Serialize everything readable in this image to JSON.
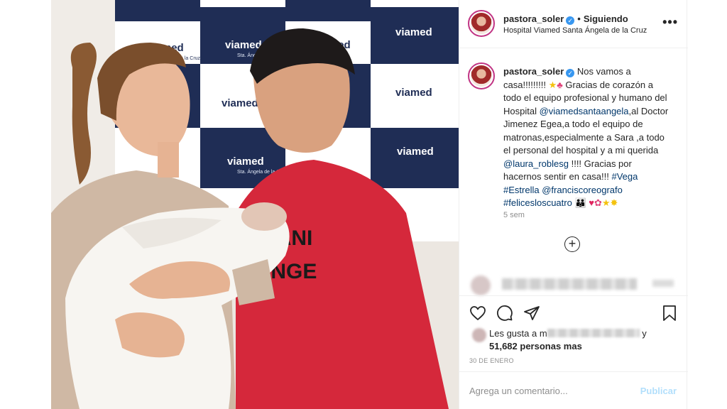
{
  "post": {
    "username": "pastora_soler",
    "verified_mark": "✓",
    "separator": "•",
    "follow_status": "Siguiendo",
    "location": "Hospital Viamed Santa Ángela de la Cruz",
    "more_icon": "more-horizontal-icon",
    "more_label": "•••"
  },
  "photo": {
    "backdrop_logo": "viamed",
    "backdrop_logo_small": "Hospital",
    "backdrop_sub": "Sta. Ángela de la Cruz",
    "shirt_line1": "RMANI",
    "shirt_line2": "HANGE"
  },
  "caption": {
    "username": "pastora_soler",
    "part1": " Nos vamos a casa!!!!!!!!! ",
    "star1": "★",
    "flower1": "♣",
    "part2": " Gracias de corazón a todo el equipo profesional y humano del Hospital ",
    "mention1": "@viamedsantaangela",
    "part3": ",al Doctor Jimenez Egea,a todo el equipo de matronas,especialmente a Sara ,a todo el personal del hospital y a mi querida ",
    "mention2": "@laura_roblesg",
    "part4": " !!!! Gracias por hacernos sentir en casa!!! ",
    "hashtag1": "#Vega",
    "hashtag2": "#Estrella",
    "mention3": "@franciscoreografo",
    "hashtag3": "#felicesloscuatro",
    "emoji_family": "👪",
    "emoji_heart": "♥",
    "emoji_bouquet": "✿",
    "emoji_star": "★",
    "emoji_sparkle": "✸",
    "time_ago": "5 sem",
    "load_more_label": "+"
  },
  "actions": {
    "like_icon": "heart-icon",
    "comment_icon": "comment-icon",
    "share_icon": "share-icon",
    "save_icon": "bookmark-icon"
  },
  "likes": {
    "prefix": "Les gusta a ",
    "visible_initial": "m",
    "suffix": " y",
    "others": "51,682 personas mas"
  },
  "date": "30 DE ENERO",
  "comment": {
    "placeholder": "Agrega un comentario...",
    "publish_label": "Publicar"
  },
  "colors": {
    "link": "#00376b",
    "verified": "#3897f0",
    "publish_disabled": "#b2dffc",
    "shirt_red": "#d5283b"
  }
}
